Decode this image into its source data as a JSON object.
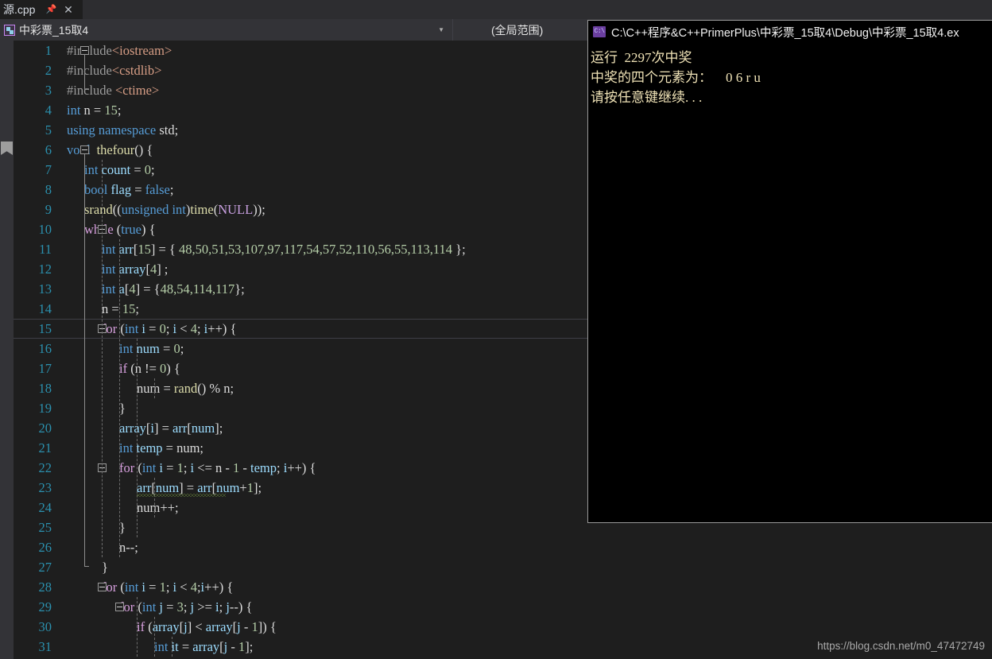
{
  "tab": {
    "title": "源.cpp",
    "pin_icon": "pin-icon",
    "close_icon": "close-icon"
  },
  "navbar": {
    "project_icon": "class-member-icon",
    "project": "中彩票_15取4",
    "caret_icon": "chevron-down-icon",
    "scope": "(全局范围)"
  },
  "console": {
    "icon": "console-app-icon",
    "title": "C:\\C++程序&C++PrimerPlus\\中彩票_15取4\\Debug\\中彩票_15取4.ex",
    "lines": [
      "运行  2297次中奖",
      "中奖的四个元素为：    0 6 r u",
      "请按任意键继续. . ."
    ]
  },
  "watermark": "https://blog.csdn.net/m0_47472749",
  "editor": {
    "current_line": 15,
    "bookmark_line": 6,
    "lines": [
      {
        "n": 1,
        "tokens": [
          {
            "t": "#include",
            "c": "pp"
          },
          {
            "t": "<iostream>",
            "c": "inc"
          }
        ]
      },
      {
        "n": 2,
        "tokens": [
          {
            "t": "#include",
            "c": "pp"
          },
          {
            "t": "<cstdlib>",
            "c": "inc"
          }
        ]
      },
      {
        "n": 3,
        "tokens": [
          {
            "t": "#include ",
            "c": "pp"
          },
          {
            "t": "<ctime>",
            "c": "inc"
          }
        ]
      },
      {
        "n": 4,
        "tokens": [
          {
            "t": "int",
            "c": "k"
          },
          {
            "t": " n = ",
            "c": "p"
          },
          {
            "t": "15",
            "c": "n"
          },
          {
            "t": ";",
            "c": "p"
          }
        ]
      },
      {
        "n": 5,
        "tokens": [
          {
            "t": "using namespace",
            "c": "k"
          },
          {
            "t": " std;",
            "c": "p"
          }
        ]
      },
      {
        "n": 6,
        "tokens": [
          {
            "t": "void",
            "c": "k"
          },
          {
            "t": "  ",
            "c": "p"
          },
          {
            "t": "thefour",
            "c": "fn"
          },
          {
            "t": "() {",
            "c": "p"
          }
        ]
      },
      {
        "n": 7,
        "tokens": [
          {
            "t": "int",
            "c": "k"
          },
          {
            "t": " ",
            "c": "p"
          },
          {
            "t": "count",
            "c": "id"
          },
          {
            "t": " = ",
            "c": "p"
          },
          {
            "t": "0",
            "c": "n"
          },
          {
            "t": ";",
            "c": "p"
          }
        ]
      },
      {
        "n": 8,
        "tokens": [
          {
            "t": "bool",
            "c": "k"
          },
          {
            "t": " ",
            "c": "p"
          },
          {
            "t": "flag",
            "c": "id"
          },
          {
            "t": " = ",
            "c": "p"
          },
          {
            "t": "false",
            "c": "k"
          },
          {
            "t": ";",
            "c": "p"
          }
        ]
      },
      {
        "n": 9,
        "tokens": [
          {
            "t": "srand",
            "c": "fn"
          },
          {
            "t": "((",
            "c": "p"
          },
          {
            "t": "unsigned int",
            "c": "k"
          },
          {
            "t": ")",
            "c": "p"
          },
          {
            "t": "time",
            "c": "fn"
          },
          {
            "t": "(",
            "c": "p"
          },
          {
            "t": "NULL",
            "c": "mac"
          },
          {
            "t": "));",
            "c": "p"
          }
        ]
      },
      {
        "n": 10,
        "tokens": [
          {
            "t": "while",
            "c": "kc"
          },
          {
            "t": " (",
            "c": "p"
          },
          {
            "t": "true",
            "c": "k"
          },
          {
            "t": ") {",
            "c": "p"
          }
        ]
      },
      {
        "n": 11,
        "tokens": [
          {
            "t": "int",
            "c": "k"
          },
          {
            "t": " ",
            "c": "p"
          },
          {
            "t": "arr",
            "c": "id"
          },
          {
            "t": "[",
            "c": "p"
          },
          {
            "t": "15",
            "c": "n"
          },
          {
            "t": "] = { ",
            "c": "p"
          },
          {
            "t": "48,50,51,53,107,97,117,54,57,52,110,56,55,113,114",
            "c": "n"
          },
          {
            "t": " };",
            "c": "p"
          }
        ]
      },
      {
        "n": 12,
        "tokens": [
          {
            "t": "int",
            "c": "k"
          },
          {
            "t": " ",
            "c": "p"
          },
          {
            "t": "array",
            "c": "id"
          },
          {
            "t": "[",
            "c": "p"
          },
          {
            "t": "4",
            "c": "n"
          },
          {
            "t": "] ;",
            "c": "p"
          }
        ]
      },
      {
        "n": 13,
        "tokens": [
          {
            "t": "int",
            "c": "k"
          },
          {
            "t": " ",
            "c": "p"
          },
          {
            "t": "a",
            "c": "id"
          },
          {
            "t": "[",
            "c": "p"
          },
          {
            "t": "4",
            "c": "n"
          },
          {
            "t": "] = {",
            "c": "p"
          },
          {
            "t": "48,54,114,117",
            "c": "n"
          },
          {
            "t": "};",
            "c": "p"
          }
        ]
      },
      {
        "n": 14,
        "tokens": [
          {
            "t": "n = ",
            "c": "p"
          },
          {
            "t": "15",
            "c": "n"
          },
          {
            "t": ";",
            "c": "p"
          }
        ]
      },
      {
        "n": 15,
        "tokens": [
          {
            "t": "for",
            "c": "kc"
          },
          {
            "t": " (",
            "c": "p"
          },
          {
            "t": "int",
            "c": "k"
          },
          {
            "t": " ",
            "c": "p"
          },
          {
            "t": "i",
            "c": "id"
          },
          {
            "t": " = ",
            "c": "p"
          },
          {
            "t": "0",
            "c": "n"
          },
          {
            "t": "; ",
            "c": "p"
          },
          {
            "t": "i",
            "c": "id"
          },
          {
            "t": " < ",
            "c": "p"
          },
          {
            "t": "4",
            "c": "n"
          },
          {
            "t": "; ",
            "c": "p"
          },
          {
            "t": "i",
            "c": "id"
          },
          {
            "t": "++) {",
            "c": "p"
          }
        ]
      },
      {
        "n": 16,
        "tokens": [
          {
            "t": "int",
            "c": "k"
          },
          {
            "t": " ",
            "c": "p"
          },
          {
            "t": "num",
            "c": "id"
          },
          {
            "t": " = ",
            "c": "p"
          },
          {
            "t": "0",
            "c": "n"
          },
          {
            "t": ";",
            "c": "p"
          }
        ]
      },
      {
        "n": 17,
        "tokens": [
          {
            "t": "if",
            "c": "kc"
          },
          {
            "t": " (n != ",
            "c": "p"
          },
          {
            "t": "0",
            "c": "n"
          },
          {
            "t": ") {",
            "c": "p"
          }
        ]
      },
      {
        "n": 18,
        "tokens": [
          {
            "t": "num = ",
            "c": "p"
          },
          {
            "t": "rand",
            "c": "fn"
          },
          {
            "t": "() % n;",
            "c": "p"
          }
        ]
      },
      {
        "n": 19,
        "tokens": [
          {
            "t": "}",
            "c": "p"
          }
        ]
      },
      {
        "n": 20,
        "tokens": [
          {
            "t": "array",
            "c": "id"
          },
          {
            "t": "[",
            "c": "p"
          },
          {
            "t": "i",
            "c": "id"
          },
          {
            "t": "] = ",
            "c": "p"
          },
          {
            "t": "arr",
            "c": "id"
          },
          {
            "t": "[",
            "c": "p"
          },
          {
            "t": "num",
            "c": "id"
          },
          {
            "t": "];",
            "c": "p"
          }
        ]
      },
      {
        "n": 21,
        "tokens": [
          {
            "t": "int",
            "c": "k"
          },
          {
            "t": " ",
            "c": "p"
          },
          {
            "t": "temp",
            "c": "id"
          },
          {
            "t": " = num;",
            "c": "p"
          }
        ]
      },
      {
        "n": 22,
        "tokens": [
          {
            "t": "for",
            "c": "kc"
          },
          {
            "t": " (",
            "c": "p"
          },
          {
            "t": "int",
            "c": "k"
          },
          {
            "t": " ",
            "c": "p"
          },
          {
            "t": "i",
            "c": "id"
          },
          {
            "t": " = ",
            "c": "p"
          },
          {
            "t": "1",
            "c": "n"
          },
          {
            "t": "; ",
            "c": "p"
          },
          {
            "t": "i",
            "c": "id"
          },
          {
            "t": " <= n - ",
            "c": "p"
          },
          {
            "t": "1",
            "c": "n"
          },
          {
            "t": " - ",
            "c": "p"
          },
          {
            "t": "temp",
            "c": "id"
          },
          {
            "t": "; ",
            "c": "p"
          },
          {
            "t": "i",
            "c": "id"
          },
          {
            "t": "++) {",
            "c": "p"
          }
        ]
      },
      {
        "n": 23,
        "tokens": [
          {
            "t": "arr",
            "c": "id"
          },
          {
            "t": "[",
            "c": "p"
          },
          {
            "t": "num",
            "c": "id"
          },
          {
            "t": "] = ",
            "c": "p"
          },
          {
            "t": "arr",
            "c": "id"
          },
          {
            "t": "[",
            "c": "p"
          },
          {
            "t": "num",
            "c": "id"
          },
          {
            "t": "+",
            "c": "p"
          },
          {
            "t": "1",
            "c": "n"
          },
          {
            "t": "];",
            "c": "p"
          }
        ]
      },
      {
        "n": 24,
        "tokens": [
          {
            "t": "num++;",
            "c": "p"
          }
        ]
      },
      {
        "n": 25,
        "tokens": [
          {
            "t": "}",
            "c": "p"
          }
        ]
      },
      {
        "n": 26,
        "tokens": [
          {
            "t": "n--;",
            "c": "p"
          }
        ]
      },
      {
        "n": 27,
        "tokens": [
          {
            "t": "}",
            "c": "p"
          }
        ]
      },
      {
        "n": 28,
        "tokens": [
          {
            "t": "for",
            "c": "kc"
          },
          {
            "t": " (",
            "c": "p"
          },
          {
            "t": "int",
            "c": "k"
          },
          {
            "t": " ",
            "c": "p"
          },
          {
            "t": "i",
            "c": "id"
          },
          {
            "t": " = ",
            "c": "p"
          },
          {
            "t": "1",
            "c": "n"
          },
          {
            "t": "; ",
            "c": "p"
          },
          {
            "t": "i",
            "c": "id"
          },
          {
            "t": " < ",
            "c": "p"
          },
          {
            "t": "4",
            "c": "n"
          },
          {
            "t": ";",
            "c": "p"
          },
          {
            "t": "i",
            "c": "id"
          },
          {
            "t": "++) {",
            "c": "p"
          }
        ]
      },
      {
        "n": 29,
        "tokens": [
          {
            "t": "for",
            "c": "kc"
          },
          {
            "t": " (",
            "c": "p"
          },
          {
            "t": "int",
            "c": "k"
          },
          {
            "t": " ",
            "c": "p"
          },
          {
            "t": "j",
            "c": "id"
          },
          {
            "t": " = ",
            "c": "p"
          },
          {
            "t": "3",
            "c": "n"
          },
          {
            "t": "; ",
            "c": "p"
          },
          {
            "t": "j",
            "c": "id"
          },
          {
            "t": " >= ",
            "c": "p"
          },
          {
            "t": "i",
            "c": "id"
          },
          {
            "t": "; ",
            "c": "p"
          },
          {
            "t": "j",
            "c": "id"
          },
          {
            "t": "--) {",
            "c": "p"
          }
        ]
      },
      {
        "n": 30,
        "tokens": [
          {
            "t": "if",
            "c": "kc"
          },
          {
            "t": " (",
            "c": "p"
          },
          {
            "t": "array",
            "c": "id"
          },
          {
            "t": "[",
            "c": "p"
          },
          {
            "t": "j",
            "c": "id"
          },
          {
            "t": "] < ",
            "c": "p"
          },
          {
            "t": "array",
            "c": "id"
          },
          {
            "t": "[",
            "c": "p"
          },
          {
            "t": "j",
            "c": "id"
          },
          {
            "t": " - ",
            "c": "p"
          },
          {
            "t": "1",
            "c": "n"
          },
          {
            "t": "]) {",
            "c": "p"
          }
        ]
      },
      {
        "n": 31,
        "tokens": [
          {
            "t": "int",
            "c": "k"
          },
          {
            "t": " ",
            "c": "p"
          },
          {
            "t": "it",
            "c": "id"
          },
          {
            "t": " = ",
            "c": "p"
          },
          {
            "t": "array",
            "c": "id"
          },
          {
            "t": "[",
            "c": "p"
          },
          {
            "t": "j",
            "c": "id"
          },
          {
            "t": " - ",
            "c": "p"
          },
          {
            "t": "1",
            "c": "n"
          },
          {
            "t": "];",
            "c": "p"
          }
        ]
      }
    ],
    "indent": {
      "1": 0,
      "2": 0,
      "3": 0,
      "4": 0,
      "5": 0,
      "6": 0,
      "7": 1,
      "8": 1,
      "9": 1,
      "10": 1,
      "11": 2,
      "12": 2,
      "13": 2,
      "14": 2,
      "15": 2,
      "16": 3,
      "17": 3,
      "18": 4,
      "19": 3,
      "20": 3,
      "21": 3,
      "22": 3,
      "23": 4,
      "24": 4,
      "25": 3,
      "26": 3,
      "27": 2,
      "28": 2,
      "29": 3,
      "30": 4,
      "31": 5
    }
  },
  "colors": {
    "editor_bg": "#1e1e1e",
    "chrome_bg": "#2d2d30",
    "navbar_bg": "#333337",
    "linenumber": "#2b91af",
    "keyword": "#569cd6",
    "control_keyword": "#d8a0df",
    "preprocessor": "#9b9b9b",
    "include_string": "#d69d85",
    "number": "#b5cea8",
    "function": "#dcdcaa",
    "identifier": "#9cdcfe",
    "macro": "#c8a0e0",
    "console_text": "#efe2b6",
    "console_bg": "#000000"
  }
}
